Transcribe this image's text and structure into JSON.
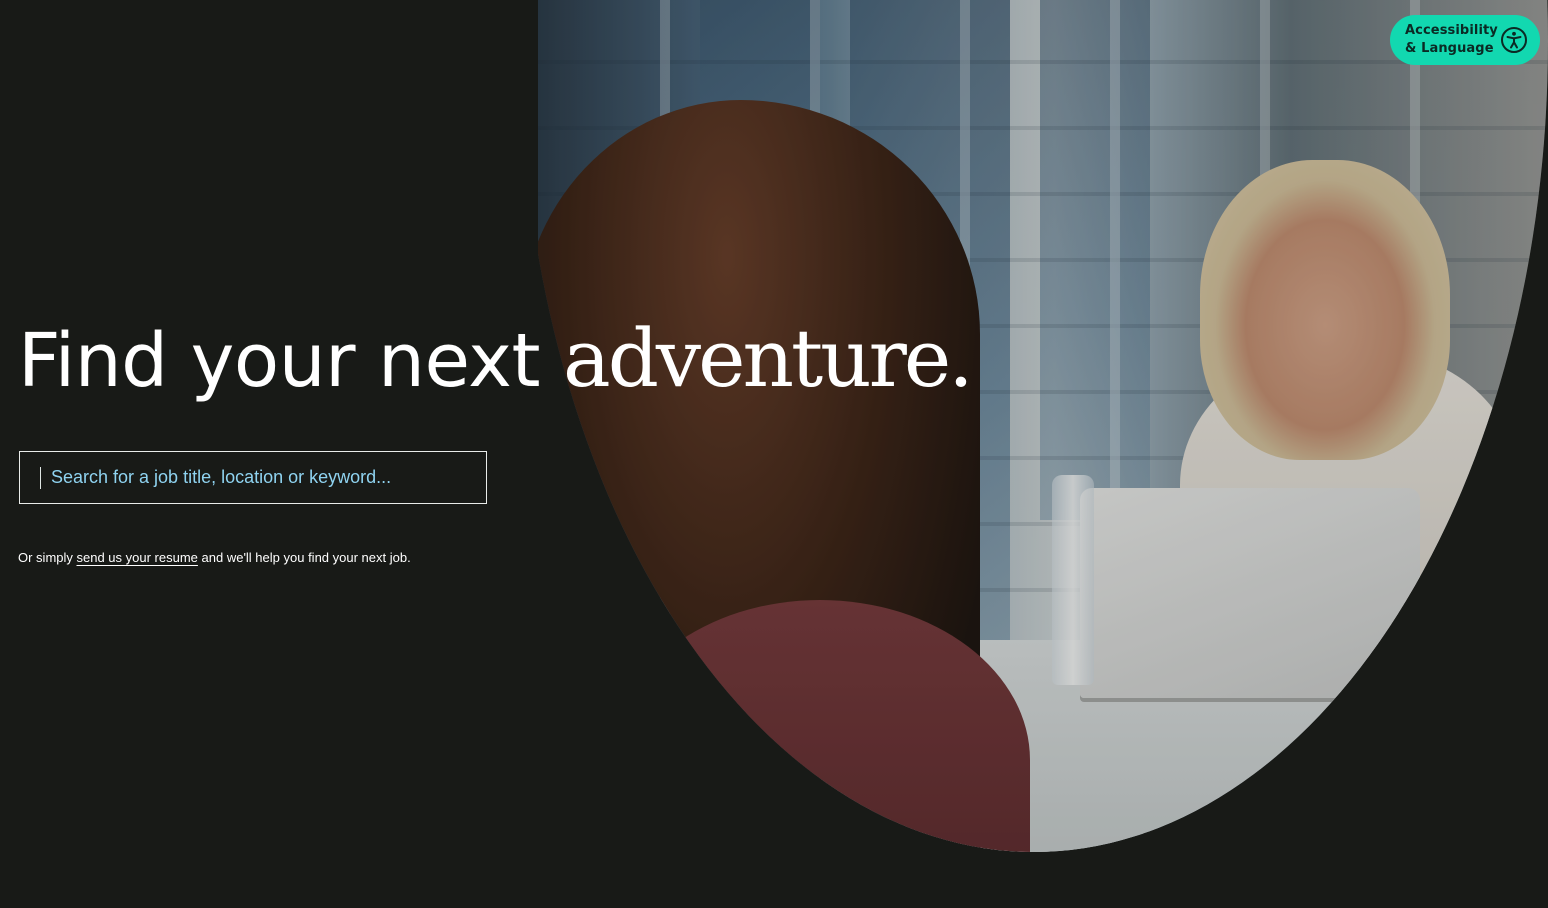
{
  "accessibility_button": {
    "line1": "Accessibility",
    "line2": "& Language",
    "icon": "accessibility-person-icon",
    "color": "#12d8b0"
  },
  "hero": {
    "headline_sans": "Find your next ",
    "headline_serif": "adventure."
  },
  "search": {
    "placeholder": "Search for a job title, location or keyword...",
    "value": ""
  },
  "resume": {
    "prefix": "Or simply ",
    "link_text": "send us your resume",
    "suffix": " and we'll help you find your next job."
  },
  "colors": {
    "background": "#181a17",
    "accent": "#12d8b0",
    "placeholder": "#8fd3f0"
  }
}
